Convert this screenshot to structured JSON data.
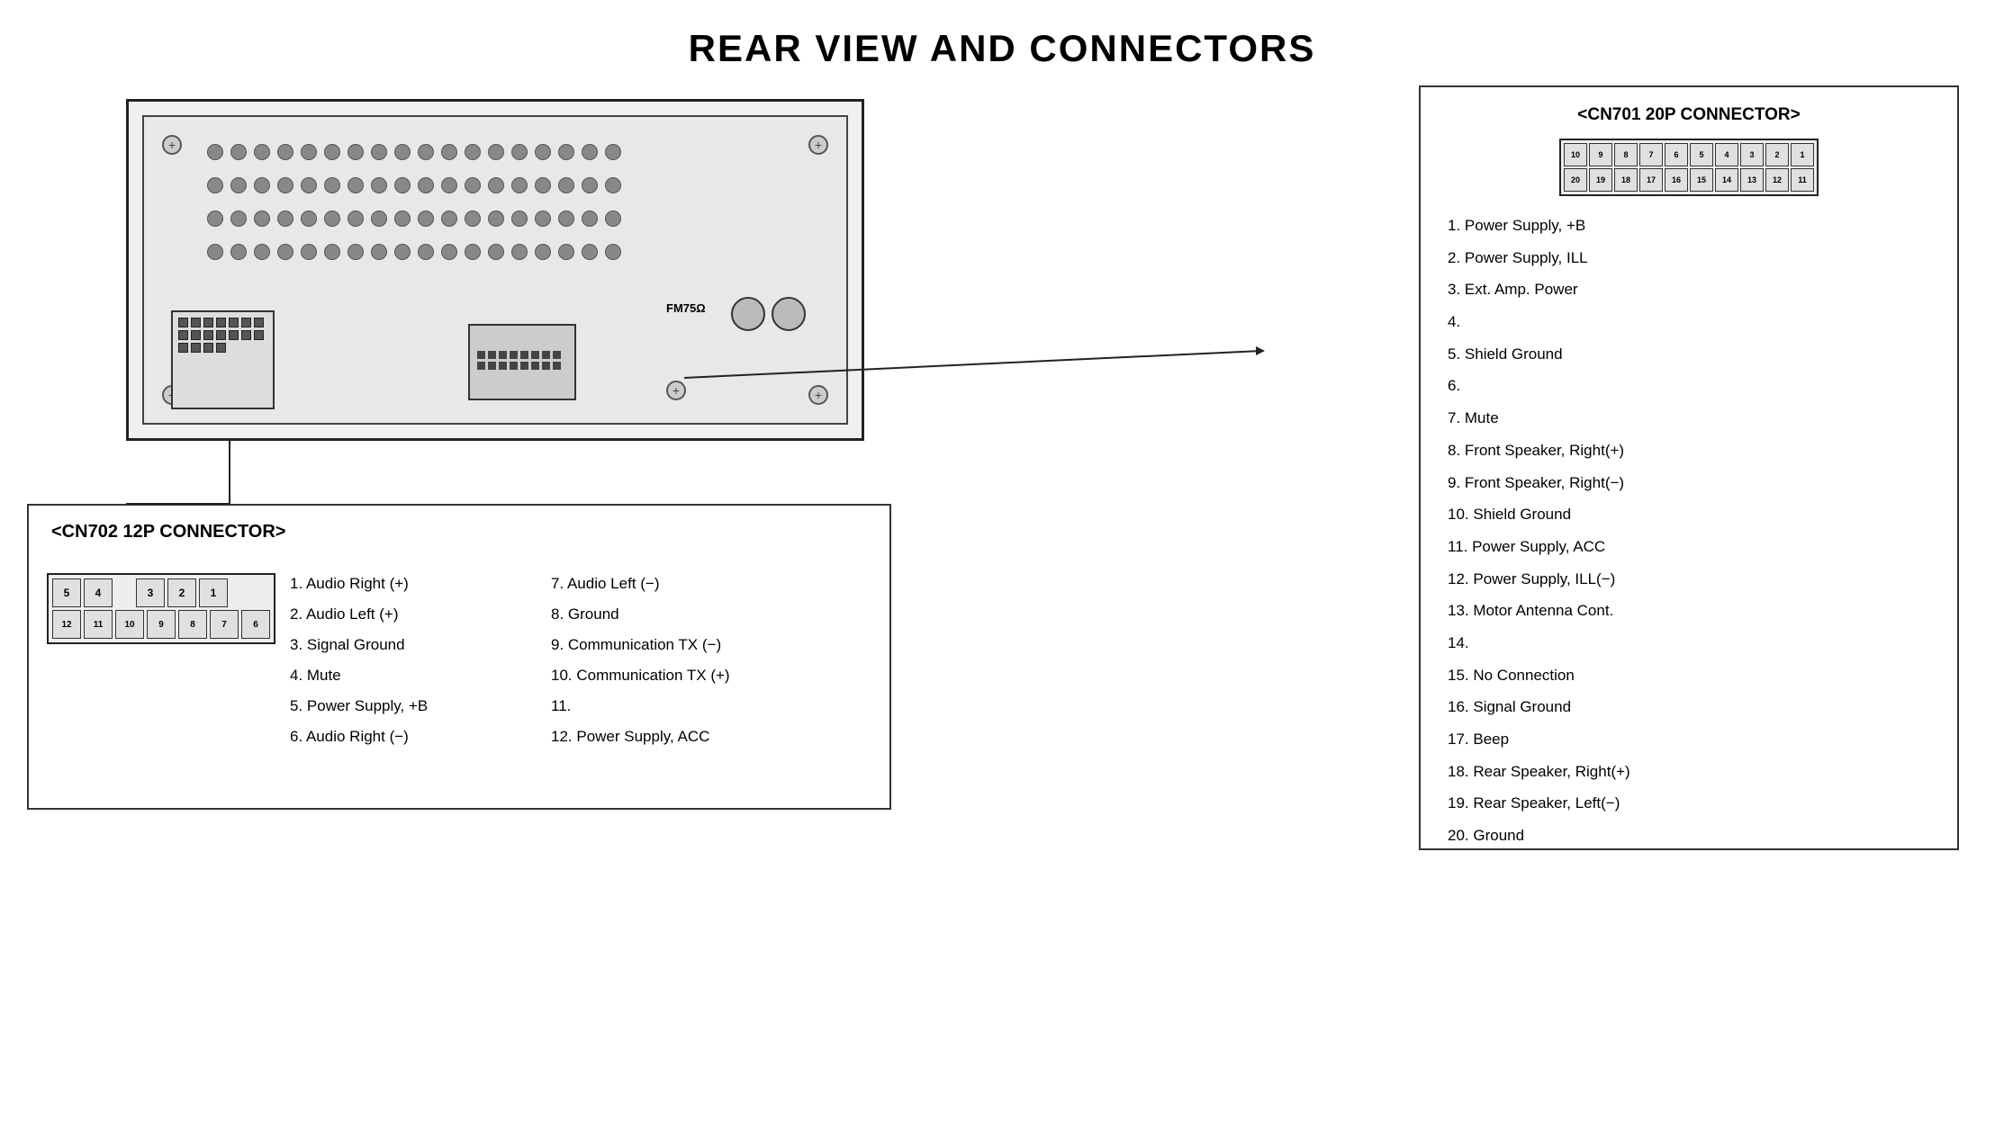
{
  "title": "REAR VIEW AND CONNECTORS",
  "cn702": {
    "label": "<CN702 12P CONNECTOR>",
    "connector_rows": [
      [
        "5",
        "4",
        "",
        "3",
        "2",
        "1"
      ],
      [
        "12",
        "11",
        "10",
        "9",
        "8",
        "7",
        "6"
      ]
    ],
    "pins_col1": [
      "1. Audio Right (+)",
      "2. Audio Left (+)",
      "3. Signal Ground",
      "4. Mute",
      "5. Power Supply, +B",
      "6. Audio Right (−)"
    ],
    "pins_col2": [
      "7. Audio Left (−)",
      "8. Ground",
      "9. Communication TX (−)",
      "10. Communication TX (+)",
      "11.",
      "12. Power Supply, ACC"
    ]
  },
  "cn701": {
    "label": "<CN701 20P CONNECTOR>",
    "connector_rows": [
      [
        "10",
        "9",
        "8",
        "7",
        "6",
        "5",
        "4",
        "3",
        "2",
        "1"
      ],
      [
        "20",
        "19",
        "18",
        "17",
        "16",
        "15",
        "14",
        "13",
        "12",
        "11"
      ]
    ],
    "pins": [
      "1.  Power Supply, +B",
      "2.  Power Supply, ILL",
      "3.  Ext. Amp. Power",
      "4.",
      "5.  Shield Ground",
      "6.",
      "7.  Mute",
      "8.  Front Speaker, Right(+)",
      "9.  Front Speaker, Right(−)",
      "10. Shield Ground",
      "11. Power Supply, ACC",
      "12. Power Supply, ILL(−)",
      "13. Motor Antenna Cont.",
      "14.",
      "15. No Connection",
      "16. Signal Ground",
      "17. Beep",
      "18. Rear Speaker, Right(+)",
      "19. Rear Speaker, Left(−)",
      "20. Ground"
    ]
  },
  "fm_label": "FM75Ω",
  "device_screws": [
    "⊕",
    "⊕",
    "⊕",
    "⊕"
  ]
}
